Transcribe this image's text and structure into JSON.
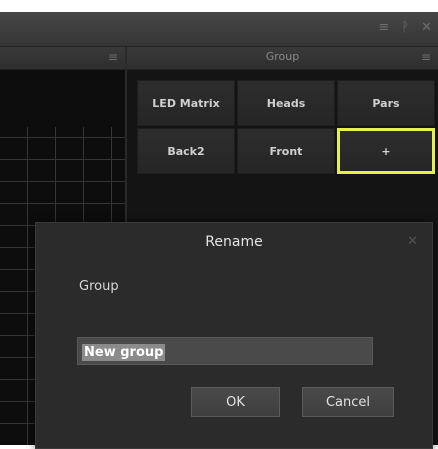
{
  "window": {
    "menu_icon": "≡",
    "pin_icon": "ᚹ",
    "close_icon": "✕"
  },
  "left_panel": {
    "menu_icon": "≡"
  },
  "group_panel": {
    "title": "Group",
    "menu_icon": "≡",
    "buttons": [
      {
        "label": "LED Matrix"
      },
      {
        "label": "Heads"
      },
      {
        "label": "Pars"
      },
      {
        "label": "Back2"
      },
      {
        "label": "Front"
      },
      {
        "label": "+"
      }
    ]
  },
  "dialog": {
    "title": "Rename",
    "close_icon": "✕",
    "label": "Group",
    "input_value": "New group",
    "ok_label": "OK",
    "cancel_label": "Cancel"
  },
  "colors": {
    "highlight": "#e6f04a"
  }
}
